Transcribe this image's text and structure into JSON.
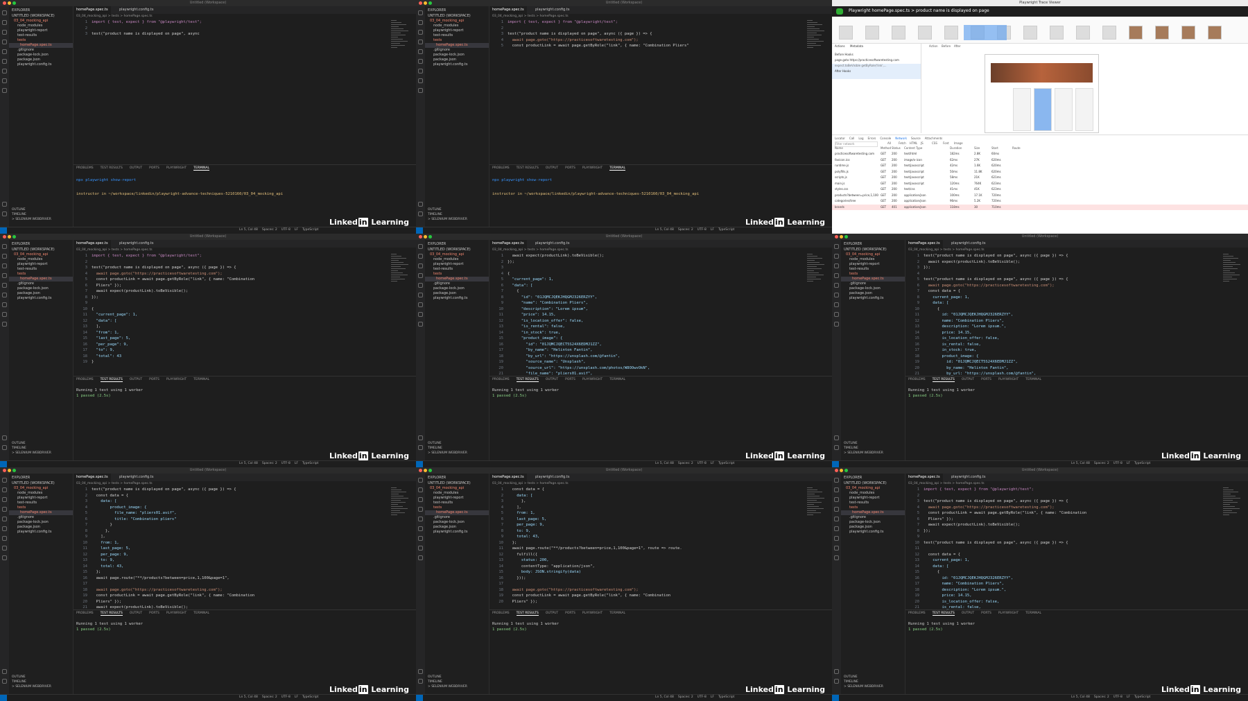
{
  "app": {
    "window_title": "Untitled (Workspace)",
    "watermark": "Linked in Learning"
  },
  "explorer": {
    "header": "EXPLORER",
    "workspace": "UNTITLED (WORKSPACE)",
    "project": "03_04_mocking_api",
    "items": [
      "node_modules",
      "playwright-report",
      "test-results",
      "tests",
      "homePage.spec.ts",
      ".gitignore",
      "package-lock.json",
      "package.json",
      "playwright.config.ts"
    ],
    "outline": "OUTLINE",
    "timeline": "TIMELINE",
    "extra": "> SELENIUM WEBDRIVER"
  },
  "editor_tabs": [
    "homePage.spec.ts",
    "playwright.config.ts"
  ],
  "breadcrumb": "03_04_mocking_api > tests > homePage.spec.ts",
  "panel_tabs": [
    "PROBLEMS",
    "TEST RESULTS",
    "OUTPUT",
    "PORTS",
    "PLAYWRIGHT",
    "TERMINAL"
  ],
  "terminal": {
    "cmd": "npx playwright show-report",
    "prompt": "instructor in ~/workspace/linkedin/playwright-advance-techniques-5210160/03_04_mocking_api",
    "running": "Running 1 test using 1 worker",
    "passed": "1 passed (2.5s)"
  },
  "status": {
    "position": "Ln 5, Col 48",
    "spaces": "Spaces: 2",
    "encoding": "UTF-8",
    "eol": "LF",
    "lang": "TypeScript"
  },
  "tiles": [
    {
      "lines": [
        "import { test, expect } from \"@playwright/test\";",
        "",
        "test(\"product name is displayed on page\", async"
      ]
    },
    {
      "lines": [
        "import { test, expect } from \"@playwright/test\";",
        "",
        "test(\"product name is displayed on page\", async ({ page }) => {",
        "  await page.goto(\"https://practicesoftwaretesting.com\");",
        "  const productLink = await page.getByRole(\"link\", { name: \"Combination Pliers\""
      ]
    },
    {
      "lines": [
        "import { test, expect } from \"@playwright/test\";",
        "",
        "test(\"product name is displayed on page\", async ({ page }) => {",
        "  await page.goto(\"https://practicesoftwaretesting.com\");",
        "  const productLink = await page.getByRole(\"link\", { name: \"Combination",
        "  Pliers\" });",
        "  await expect(productLink).toBeVisible();",
        "});",
        "",
        "{",
        "  \"current_page\": 1,",
        "  \"data\": [",
        "  ],",
        "  \"from\": 1,",
        "  \"last_page\": 5,",
        "  \"per_page\": 9,",
        "  \"to\": 9,",
        "  \"total\": 43",
        "}"
      ]
    },
    {
      "lines": [
        "  await expect(productLink).toBeVisible();",
        "});",
        "",
        "{",
        "  \"current_page\": 1,",
        "  \"data\": [",
        "    {",
        "      \"id\": \"01JQMCJQEKJHQGMJ326ERZYY\",",
        "      \"name\": \"Combination Pliers\",",
        "      \"description\": \"Lorem ipsum\",",
        "      \"price\": 14.15,",
        "      \"is_location_offer\": false,",
        "      \"is_rental\": false,",
        "      \"in_stock\": true,",
        "      \"product_image\": {",
        "        \"id\": \"01JQMCJQECT5S24X6EDMJ1ZZ\",",
        "        \"by_name\": \"Helinton Fantin\",",
        "        \"by_url\": \"https://unsplash.com/@fantin\",",
        "        \"source_name\": \"Unsplash\",",
        "        \"source_url\": \"https://unsplash.com/photos/W8OOwvOkN\",",
        "        \"file_name\": \"pliers01.avif\",",
        "        \"title\": \"Combination pliers\""
      ]
    },
    {
      "lines": [
        "test(\"product name is displayed on page\", async ({ page }) => {",
        "  await expect(productLink).toBeVisible();",
        "});",
        "",
        "test(\"product name is displayed on page\", async ({ page }) => {",
        "  await page.goto(\"https://practicesoftwaretesting.com\");",
        "  const data = {",
        "    current_page: 1,",
        "    data: [",
        "      {",
        "        id: \"01JQMCJQEKJHQGMJ326ERZYY\",",
        "        name: \"Combination Pliers\",",
        "        description: \"Lorem ipsum.\",",
        "        price: 14.15,",
        "        is_location_offer: false,",
        "        is_rental: false,",
        "        in_stock: true,",
        "        product_image: {",
        "          id: \"01JQMCJQECT5S24X6EDMJ1ZZ\",",
        "          by_name: \"Helinton Fantin\",",
        "          by_url: \"https://unsplash.com/@fantin\",",
        "          source_name: \"Unsplash\","
      ]
    },
    {
      "lines": [
        "test(\"product name is displayed on page\", async ({ page }) => {",
        "  const data = {",
        "    data: [",
        "        product_image: {",
        "          file_name: \"pliers01.avif\",",
        "          title: \"Combination pliers\"",
        "        }",
        "      },",
        "    ],",
        "    from: 1,",
        "    last_page: 5,",
        "    per_page: 9,",
        "    to: 9,",
        "    total: 43,",
        "  };",
        "  await page.route(\"**/products?between=price,1,100&page=1\",",
        "",
        "  await page.goto(\"https://practicesoftwaretesting.com\");",
        "  const productLink = await page.getByRole(\"link\", { name: \"Combination",
        "  Pliers\" });",
        "  await expect(productLink).toBeVisible();",
        "});"
      ]
    },
    {
      "lines": [
        "  const data = {",
        "    data: [",
        "      },",
        "    ],",
        "    from: 1,",
        "    last_page: 5,",
        "    per_page: 9,",
        "    to: 9,",
        "    total: 43,",
        "  };",
        "  await page.route(\"**/products?between=price,1,100&page=1\", route => route.",
        "    fulfill({",
        "      status: 200,",
        "      contentType: \"application/json\",",
        "      body: JSON.stringify(data)",
        "    }));",
        "",
        "  await page.goto(\"https://practicesoftwaretesting.com\");",
        "  const productLink = await page.getByRole(\"link\", { name: \"Combination",
        "  Pliers\" });"
      ]
    },
    {
      "lines": [
        "import { test, expect } from \"@playwright/test\";",
        "",
        "test(\"product name is displayed on page\", async ({ page }) => {",
        "  await page.goto(\"https://practicesoftwaretesting.com\");",
        "  const productLink = await page.getByRole(\"link\", { name: \"Combination",
        "  Pliers\" });",
        "  await expect(productLink).toBeVisible();",
        "});",
        "",
        "test(\"product name is displayed on page\", async ({ page }) => {",
        "",
        "  const data = {",
        "    current_page: 1,",
        "    data: [",
        "      {",
        "        id: \"01JQMCJQEKJHQGMJ326ERZYY\",",
        "        name: \"Combination Pliers\",",
        "        description: \"Lorem ipsum.\",",
        "        price: 14.15,",
        "        is_location_offer: false,",
        "        is_rental: false,",
        "        in_stock: true,",
        "        product_image: {"
      ]
    }
  ],
  "trace_viewer": {
    "window_title": "Playwright Trace Viewer",
    "header": "Playwright   homePage.spec.ts > product name is displayed on page",
    "tabs": [
      "Actions",
      "Metadata"
    ],
    "actions": [
      "Before Hooks",
      "page.goto https://practicesoftwaretesting.com",
      "expect.toBeVisible getByRole('link',...",
      "After Hooks"
    ],
    "preview_tabs": [
      "Action",
      "Before",
      "After"
    ],
    "bottom_tabs": [
      "Locator",
      "Call",
      "Log",
      "Errors",
      "Console",
      "Network",
      "Source",
      "Attachments"
    ],
    "filter": "Filter network",
    "filters": [
      "All",
      "Fetch",
      "HTML",
      "JS",
      "CSS",
      "Font",
      "Image"
    ],
    "columns": [
      "Name",
      "Method",
      "Status",
      "Content Type",
      "Duration",
      "Size",
      "Start",
      "Route"
    ],
    "rows": [
      [
        "practicesoftwaretesting.com",
        "GET",
        "200",
        "text/html",
        "182ms",
        "2.8K",
        "60ms"
      ],
      [
        "favicon.ico",
        "GET",
        "200",
        "image/x-icon",
        "62ms",
        "27K",
        "620ms"
      ],
      [
        "runtime.js",
        "GET",
        "200",
        "text/javascript",
        "42ms",
        "1.6K",
        "620ms"
      ],
      [
        "polyfills.js",
        "GET",
        "200",
        "text/javascript",
        "50ms",
        "11.8K",
        "620ms"
      ],
      [
        "scripts.js",
        "GET",
        "200",
        "text/javascript",
        "58ms",
        "21K",
        "621ms"
      ],
      [
        "main.js",
        "GET",
        "200",
        "text/javascript",
        "120ms",
        "764K",
        "623ms"
      ],
      [
        "styles.css",
        "GET",
        "200",
        "text/css",
        "41ms",
        "41K",
        "623ms"
      ],
      [
        "products?between=price,1,100",
        "GET",
        "200",
        "application/json",
        "100ms",
        "17.1K",
        "720ms"
      ],
      [
        "categories/tree",
        "GET",
        "200",
        "application/json",
        "96ms",
        "5.2K",
        "720ms"
      ],
      [
        "brands",
        "GET",
        "401",
        "application/json",
        "118ms",
        "30",
        "710ms"
      ]
    ]
  }
}
